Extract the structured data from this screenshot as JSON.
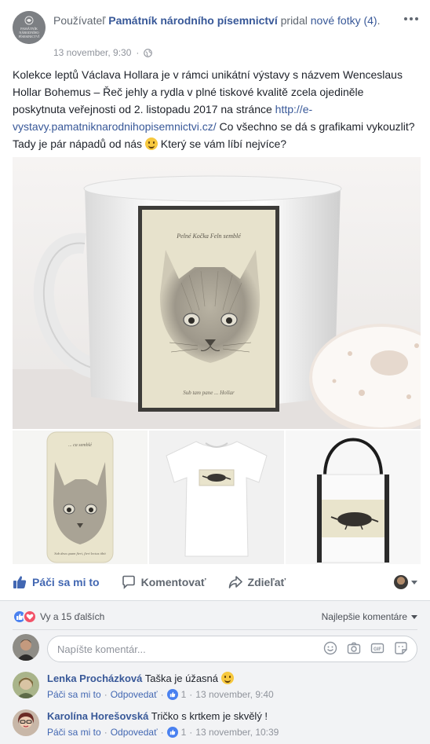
{
  "post": {
    "header_prefix": "Používateľ",
    "page_name": "Památník národního písemnictví",
    "header_verb": "pridal",
    "new_photos_link": "nové fotky (4)",
    "header_end": ".",
    "timestamp": "13 november, 9:30",
    "meta_separator": "·",
    "avatar_lines": [
      "PAMÁTNÍK",
      "NÁRODNÍHO",
      "PÍSEMNICTVÍ"
    ],
    "text_1": "Kolekce leptů Václava Hollara je v rámci unikátní výstavy s názvem Wenceslaus Hollar Bohemus – Řeč jehly a rydla v plné tiskové kvalitě zcela ojediněle poskytnuta veřejnosti od 2. listopadu 2017 na stránce ",
    "link_text": "http://e-vystavy.pamatniknarodnihopisemnictvi.cz/",
    "text_2": " Co všechno se dá s grafikami vykouzlit? Tady je pár nápadů od nás ",
    "text_3": " Který se vám líbí nejvíce?"
  },
  "photos": {
    "mug_top_inscription": "Pelné Kočka Feln semblé",
    "mug_bottom_inscription": "Sub tam pane ... Hollar",
    "phone_top_inscription": "... ca semblé",
    "phone_bottom_inscription": "Sub deus quam fieri, fieri lectus tibit"
  },
  "actions": {
    "like": "Páči sa mi to",
    "comment": "Komentovať",
    "share": "Zdieľať"
  },
  "reactions": {
    "count_text": "Vy a 15 ďalších",
    "sort_label": "Najlepšie komentáre"
  },
  "composer": {
    "placeholder": "Napíšte komentár..."
  },
  "comments": [
    {
      "author": "Lenka Procházková",
      "text": "Taška je úžasná",
      "like_label": "Páči sa mi to",
      "reply_label": "Odpovedať",
      "likes": "1",
      "time": "13 november, 9:40"
    },
    {
      "author": "Karolína Horešovská",
      "text": "Tričko s krtkem je skvělý !",
      "like_label": "Páči sa mi to",
      "reply_label": "Odpovedať",
      "likes": "1",
      "time": "13 november, 10:39"
    }
  ],
  "meta_dot": "·",
  "colors": {
    "link": "#385898",
    "like_blue": "#4267b2",
    "love_red": "#f25268",
    "comments_bg": "#f2f3f5"
  }
}
